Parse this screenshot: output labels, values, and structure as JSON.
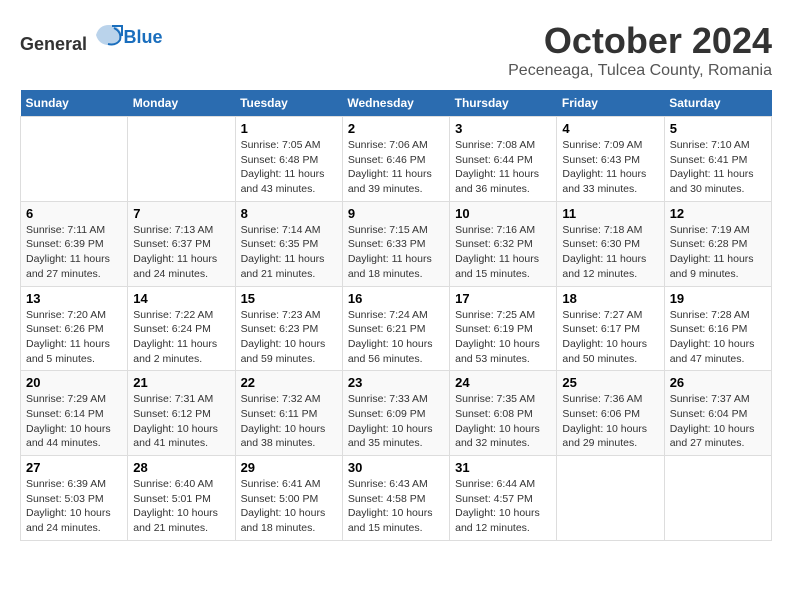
{
  "header": {
    "logo_general": "General",
    "logo_blue": "Blue",
    "month_title": "October 2024",
    "subtitle": "Peceneaga, Tulcea County, Romania"
  },
  "weekdays": [
    "Sunday",
    "Monday",
    "Tuesday",
    "Wednesday",
    "Thursday",
    "Friday",
    "Saturday"
  ],
  "weeks": [
    [
      {
        "day": "",
        "sunrise": "",
        "sunset": "",
        "daylight": ""
      },
      {
        "day": "",
        "sunrise": "",
        "sunset": "",
        "daylight": ""
      },
      {
        "day": "1",
        "sunrise": "Sunrise: 7:05 AM",
        "sunset": "Sunset: 6:48 PM",
        "daylight": "Daylight: 11 hours and 43 minutes."
      },
      {
        "day": "2",
        "sunrise": "Sunrise: 7:06 AM",
        "sunset": "Sunset: 6:46 PM",
        "daylight": "Daylight: 11 hours and 39 minutes."
      },
      {
        "day": "3",
        "sunrise": "Sunrise: 7:08 AM",
        "sunset": "Sunset: 6:44 PM",
        "daylight": "Daylight: 11 hours and 36 minutes."
      },
      {
        "day": "4",
        "sunrise": "Sunrise: 7:09 AM",
        "sunset": "Sunset: 6:43 PM",
        "daylight": "Daylight: 11 hours and 33 minutes."
      },
      {
        "day": "5",
        "sunrise": "Sunrise: 7:10 AM",
        "sunset": "Sunset: 6:41 PM",
        "daylight": "Daylight: 11 hours and 30 minutes."
      }
    ],
    [
      {
        "day": "6",
        "sunrise": "Sunrise: 7:11 AM",
        "sunset": "Sunset: 6:39 PM",
        "daylight": "Daylight: 11 hours and 27 minutes."
      },
      {
        "day": "7",
        "sunrise": "Sunrise: 7:13 AM",
        "sunset": "Sunset: 6:37 PM",
        "daylight": "Daylight: 11 hours and 24 minutes."
      },
      {
        "day": "8",
        "sunrise": "Sunrise: 7:14 AM",
        "sunset": "Sunset: 6:35 PM",
        "daylight": "Daylight: 11 hours and 21 minutes."
      },
      {
        "day": "9",
        "sunrise": "Sunrise: 7:15 AM",
        "sunset": "Sunset: 6:33 PM",
        "daylight": "Daylight: 11 hours and 18 minutes."
      },
      {
        "day": "10",
        "sunrise": "Sunrise: 7:16 AM",
        "sunset": "Sunset: 6:32 PM",
        "daylight": "Daylight: 11 hours and 15 minutes."
      },
      {
        "day": "11",
        "sunrise": "Sunrise: 7:18 AM",
        "sunset": "Sunset: 6:30 PM",
        "daylight": "Daylight: 11 hours and 12 minutes."
      },
      {
        "day": "12",
        "sunrise": "Sunrise: 7:19 AM",
        "sunset": "Sunset: 6:28 PM",
        "daylight": "Daylight: 11 hours and 9 minutes."
      }
    ],
    [
      {
        "day": "13",
        "sunrise": "Sunrise: 7:20 AM",
        "sunset": "Sunset: 6:26 PM",
        "daylight": "Daylight: 11 hours and 5 minutes."
      },
      {
        "day": "14",
        "sunrise": "Sunrise: 7:22 AM",
        "sunset": "Sunset: 6:24 PM",
        "daylight": "Daylight: 11 hours and 2 minutes."
      },
      {
        "day": "15",
        "sunrise": "Sunrise: 7:23 AM",
        "sunset": "Sunset: 6:23 PM",
        "daylight": "Daylight: 10 hours and 59 minutes."
      },
      {
        "day": "16",
        "sunrise": "Sunrise: 7:24 AM",
        "sunset": "Sunset: 6:21 PM",
        "daylight": "Daylight: 10 hours and 56 minutes."
      },
      {
        "day": "17",
        "sunrise": "Sunrise: 7:25 AM",
        "sunset": "Sunset: 6:19 PM",
        "daylight": "Daylight: 10 hours and 53 minutes."
      },
      {
        "day": "18",
        "sunrise": "Sunrise: 7:27 AM",
        "sunset": "Sunset: 6:17 PM",
        "daylight": "Daylight: 10 hours and 50 minutes."
      },
      {
        "day": "19",
        "sunrise": "Sunrise: 7:28 AM",
        "sunset": "Sunset: 6:16 PM",
        "daylight": "Daylight: 10 hours and 47 minutes."
      }
    ],
    [
      {
        "day": "20",
        "sunrise": "Sunrise: 7:29 AM",
        "sunset": "Sunset: 6:14 PM",
        "daylight": "Daylight: 10 hours and 44 minutes."
      },
      {
        "day": "21",
        "sunrise": "Sunrise: 7:31 AM",
        "sunset": "Sunset: 6:12 PM",
        "daylight": "Daylight: 10 hours and 41 minutes."
      },
      {
        "day": "22",
        "sunrise": "Sunrise: 7:32 AM",
        "sunset": "Sunset: 6:11 PM",
        "daylight": "Daylight: 10 hours and 38 minutes."
      },
      {
        "day": "23",
        "sunrise": "Sunrise: 7:33 AM",
        "sunset": "Sunset: 6:09 PM",
        "daylight": "Daylight: 10 hours and 35 minutes."
      },
      {
        "day": "24",
        "sunrise": "Sunrise: 7:35 AM",
        "sunset": "Sunset: 6:08 PM",
        "daylight": "Daylight: 10 hours and 32 minutes."
      },
      {
        "day": "25",
        "sunrise": "Sunrise: 7:36 AM",
        "sunset": "Sunset: 6:06 PM",
        "daylight": "Daylight: 10 hours and 29 minutes."
      },
      {
        "day": "26",
        "sunrise": "Sunrise: 7:37 AM",
        "sunset": "Sunset: 6:04 PM",
        "daylight": "Daylight: 10 hours and 27 minutes."
      }
    ],
    [
      {
        "day": "27",
        "sunrise": "Sunrise: 6:39 AM",
        "sunset": "Sunset: 5:03 PM",
        "daylight": "Daylight: 10 hours and 24 minutes."
      },
      {
        "day": "28",
        "sunrise": "Sunrise: 6:40 AM",
        "sunset": "Sunset: 5:01 PM",
        "daylight": "Daylight: 10 hours and 21 minutes."
      },
      {
        "day": "29",
        "sunrise": "Sunrise: 6:41 AM",
        "sunset": "Sunset: 5:00 PM",
        "daylight": "Daylight: 10 hours and 18 minutes."
      },
      {
        "day": "30",
        "sunrise": "Sunrise: 6:43 AM",
        "sunset": "Sunset: 4:58 PM",
        "daylight": "Daylight: 10 hours and 15 minutes."
      },
      {
        "day": "31",
        "sunrise": "Sunrise: 6:44 AM",
        "sunset": "Sunset: 4:57 PM",
        "daylight": "Daylight: 10 hours and 12 minutes."
      },
      {
        "day": "",
        "sunrise": "",
        "sunset": "",
        "daylight": ""
      },
      {
        "day": "",
        "sunrise": "",
        "sunset": "",
        "daylight": ""
      }
    ]
  ]
}
